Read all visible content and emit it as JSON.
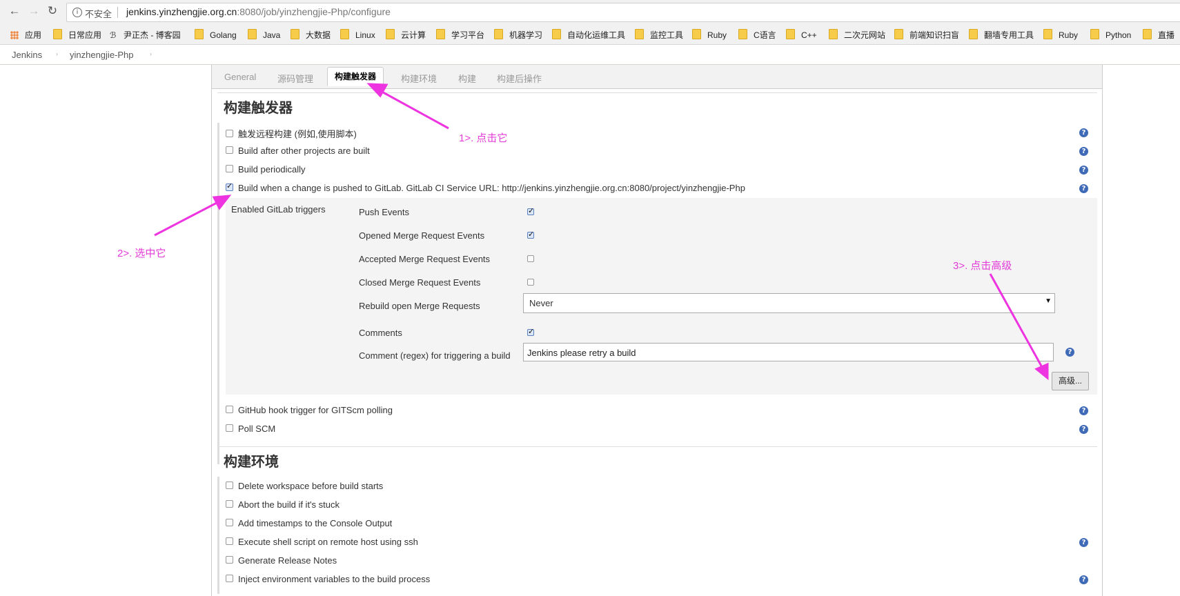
{
  "browser": {
    "insecure_label": "不安全",
    "url_host": "jenkins.yinzhengjie.org.cn",
    "url_path": ":8080/job/yinzhengjie-Php/configure",
    "bookmarks": [
      "应用",
      "日常应用",
      "尹正杰 - 博客园",
      "Golang",
      "Java",
      "大数据",
      "Linux",
      "云计算",
      "学习平台",
      "机器学习",
      "自动化运维工具",
      "监控工具",
      "Ruby",
      "C语言",
      "C++",
      "二次元网站",
      "前端知识扫盲",
      "翻墙专用工具",
      "Ruby",
      "Python",
      "直播"
    ]
  },
  "breadcrumb": {
    "root": "Jenkins",
    "job": "yinzhengjie-Php"
  },
  "tabs": [
    "General",
    "源码管理",
    "构建触发器",
    "构建环境",
    "构建",
    "构建后操作"
  ],
  "active_tab": "构建触发器",
  "triggers": {
    "title": "构建触发器",
    "items": [
      {
        "label": "触发远程构建 (例如,使用脚本)",
        "checked": false
      },
      {
        "label": "Build after other projects are built",
        "checked": false
      },
      {
        "label": "Build periodically",
        "checked": false
      },
      {
        "label": "Build when a change is pushed to GitLab. GitLab CI Service URL: http://jenkins.yinzhengjie.org.cn:8080/project/yinzhengjie-Php",
        "checked": true
      },
      {
        "label": "GitHub hook trigger for GITScm polling",
        "checked": false
      },
      {
        "label": "Poll SCM",
        "checked": false
      }
    ],
    "gitlab": {
      "enabled_label": "Enabled GitLab triggers",
      "push_events": "Push Events",
      "opened_mr": "Opened Merge Request Events",
      "accepted_mr": "Accepted Merge Request Events",
      "closed_mr": "Closed Merge Request Events",
      "rebuild_label": "Rebuild open Merge Requests",
      "rebuild_value": "Never",
      "comments": "Comments",
      "comment_regex_label": "Comment (regex) for triggering a build",
      "comment_regex_value": "Jenkins please retry a build",
      "advanced_button": "高级..."
    }
  },
  "environment": {
    "title": "构建环境",
    "items": [
      "Delete workspace before build starts",
      "Abort the build if it's stuck",
      "Add timestamps to the Console Output",
      "Execute shell script on remote host using ssh",
      "Generate Release Notes",
      "Inject environment variables to the build process"
    ]
  },
  "annotations": {
    "step1": "1>. 点击它",
    "step2": "2>. 选中它",
    "step3": "3>. 点击高级"
  },
  "colors": {
    "annotation": "#e33bd8",
    "help_icon": "#3f6ab7"
  }
}
